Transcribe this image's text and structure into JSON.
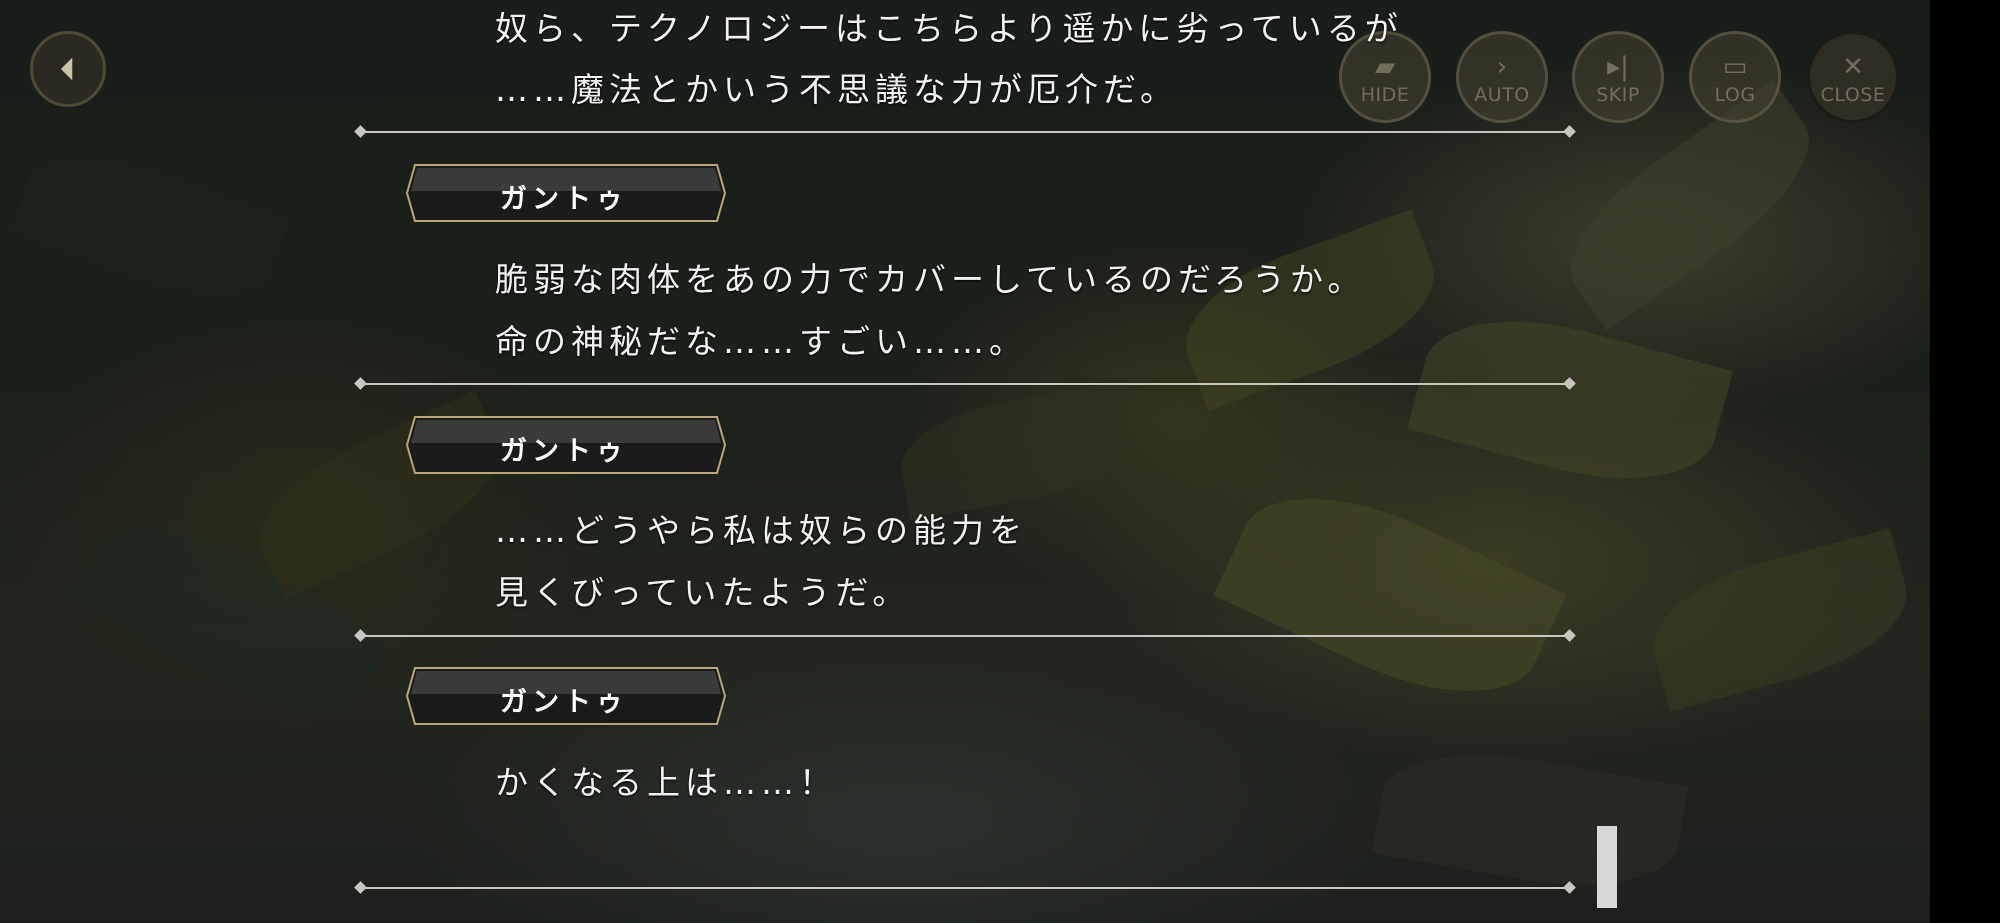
{
  "back_button": {
    "icon": "back-arrow-icon"
  },
  "controls": [
    {
      "label": "HIDE",
      "icon": "hide-icon"
    },
    {
      "label": "AUTO",
      "icon": "auto-icon"
    },
    {
      "label": "SKIP",
      "icon": "skip-icon"
    },
    {
      "label": "LOG",
      "icon": "log-icon"
    },
    {
      "label": "CLOSE",
      "icon": "close-icon"
    }
  ],
  "log": {
    "entries": [
      {
        "lines": [
          "奴ら、テクノロジーはこちらより遥かに劣っているが",
          "……魔法とかいう不思議な力が厄介だ。"
        ]
      },
      {
        "speaker": "ガントゥ",
        "lines": [
          "脆弱な肉体をあの力でカバーしているのだろうか。",
          "命の神秘だな……すごい……。"
        ]
      },
      {
        "speaker": "ガントゥ",
        "lines": [
          "……どうやら私は奴らの能力を",
          "見くびっていたようだ。"
        ]
      },
      {
        "speaker": "ガントゥ",
        "lines": [
          "かくなる上は……！"
        ]
      }
    ]
  },
  "colors": {
    "accent_gold": "#b8a77a",
    "text": "#f2f2f2",
    "divider": "#c8c6bf"
  }
}
